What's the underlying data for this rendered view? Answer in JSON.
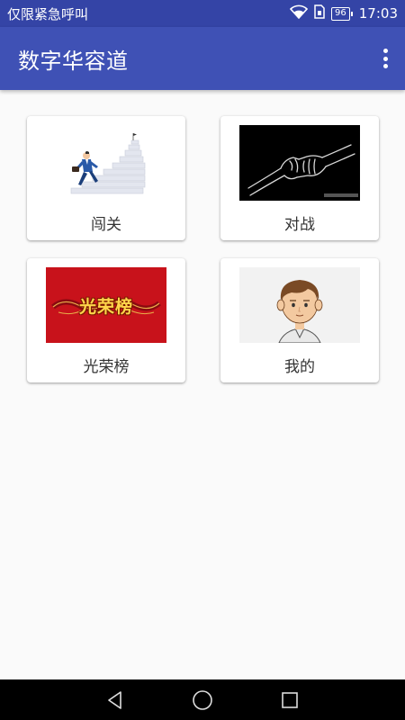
{
  "status_bar": {
    "carrier_text": "仅限紧急呼叫",
    "battery": "96",
    "time": "17:03",
    "icons": [
      "wifi-icon",
      "sim-icon",
      "battery-icon"
    ]
  },
  "app_bar": {
    "title": "数字华容道",
    "menu_icon": "overflow-menu-icon"
  },
  "menu": [
    {
      "label": "闯关",
      "image": "stairs-businessman"
    },
    {
      "label": "对战",
      "image": "fist-bump"
    },
    {
      "label": "光荣榜",
      "image": "honor-banner",
      "banner_text": "光荣榜"
    },
    {
      "label": "我的",
      "image": "cartoon-avatar"
    }
  ],
  "nav_bar": {
    "icons": [
      "back-icon",
      "home-icon",
      "recents-icon"
    ]
  },
  "colors": {
    "primary": "#3f51b5",
    "primary_dark": "#3444a6",
    "background": "#fafafa",
    "banner_red": "#c8121b"
  }
}
